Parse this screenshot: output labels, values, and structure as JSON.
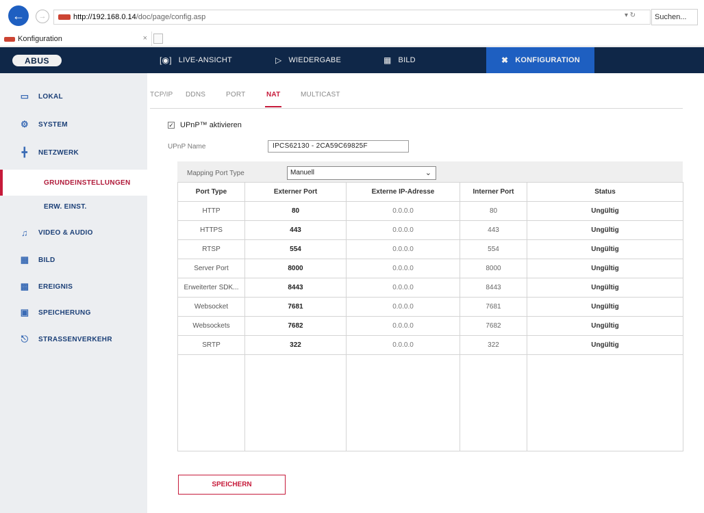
{
  "browser": {
    "url_host": "http://192.168.0.14",
    "url_path": "/doc/page/config.asp",
    "url_actions": "▾ ↻",
    "search_placeholder": "Suchen...",
    "tab_title": "Konfiguration",
    "tab_close": "×"
  },
  "header": {
    "logo": "ABUS",
    "nav": [
      {
        "label": "LIVE-ANSICHT",
        "icon": "live-view-icon"
      },
      {
        "label": "WIEDERGABE",
        "icon": "play-icon"
      },
      {
        "label": "BILD",
        "icon": "image-icon"
      },
      {
        "label": "KONFIGURATION",
        "icon": "tools-icon"
      }
    ]
  },
  "sidebar": {
    "items": [
      {
        "label": "LOKAL",
        "icon": "monitor-icon"
      },
      {
        "label": "SYSTEM",
        "icon": "gear-icon"
      },
      {
        "label": "NETZWERK",
        "icon": "network-icon"
      },
      {
        "label": "GRUNDEINSTELLUNGEN",
        "sub": true,
        "active": true
      },
      {
        "label": "ERW. EINST.",
        "sub": true
      },
      {
        "label": "VIDEO & AUDIO",
        "icon": "microphone-icon"
      },
      {
        "label": "BILD",
        "icon": "image-icon"
      },
      {
        "label": "EREIGNIS",
        "icon": "calendar-icon"
      },
      {
        "label": "SPEICHERUNG",
        "icon": "save-disk-icon"
      },
      {
        "label": "STRAßENVERKEHR",
        "icon": "car-icon"
      }
    ]
  },
  "subtabs": [
    "TCP/IP",
    "DDNS",
    "PORT",
    "NAT",
    "MULTICAST"
  ],
  "active_subtab": "NAT",
  "upnp": {
    "checkbox_label": "UPnP™ aktivieren",
    "checked": true,
    "name_label": "UPnP Name",
    "name_value": "IPCS62130 - 2CA59C69825F"
  },
  "mapping": {
    "label": "Mapping Port Type",
    "selected": "Manuell"
  },
  "table": {
    "headers": [
      "Port Type",
      "Externer Port",
      "Externe IP-Adresse",
      "Interner Port",
      "Status"
    ],
    "rows": [
      [
        "HTTP",
        "80",
        "0.0.0.0",
        "80",
        "Ungültig"
      ],
      [
        "HTTPS",
        "443",
        "0.0.0.0",
        "443",
        "Ungültig"
      ],
      [
        "RTSP",
        "554",
        "0.0.0.0",
        "554",
        "Ungültig"
      ],
      [
        "Server Port",
        "8000",
        "0.0.0.0",
        "8000",
        "Ungültig"
      ],
      [
        "Erweiterter SDK...",
        "8443",
        "0.0.0.0",
        "8443",
        "Ungültig"
      ],
      [
        "Websocket",
        "7681",
        "0.0.0.0",
        "7681",
        "Ungültig"
      ],
      [
        "Websockets",
        "7682",
        "0.0.0.0",
        "7682",
        "Ungültig"
      ],
      [
        "SRTP",
        "322",
        "0.0.0.0",
        "322",
        "Ungültig"
      ]
    ]
  },
  "save_label": "SPEICHERN",
  "colors": {
    "header_bg": "#0f2748",
    "active_nav": "#1e5fc1",
    "accent_red": "#c61a3a",
    "sidebar_bg": "#eceef1"
  }
}
